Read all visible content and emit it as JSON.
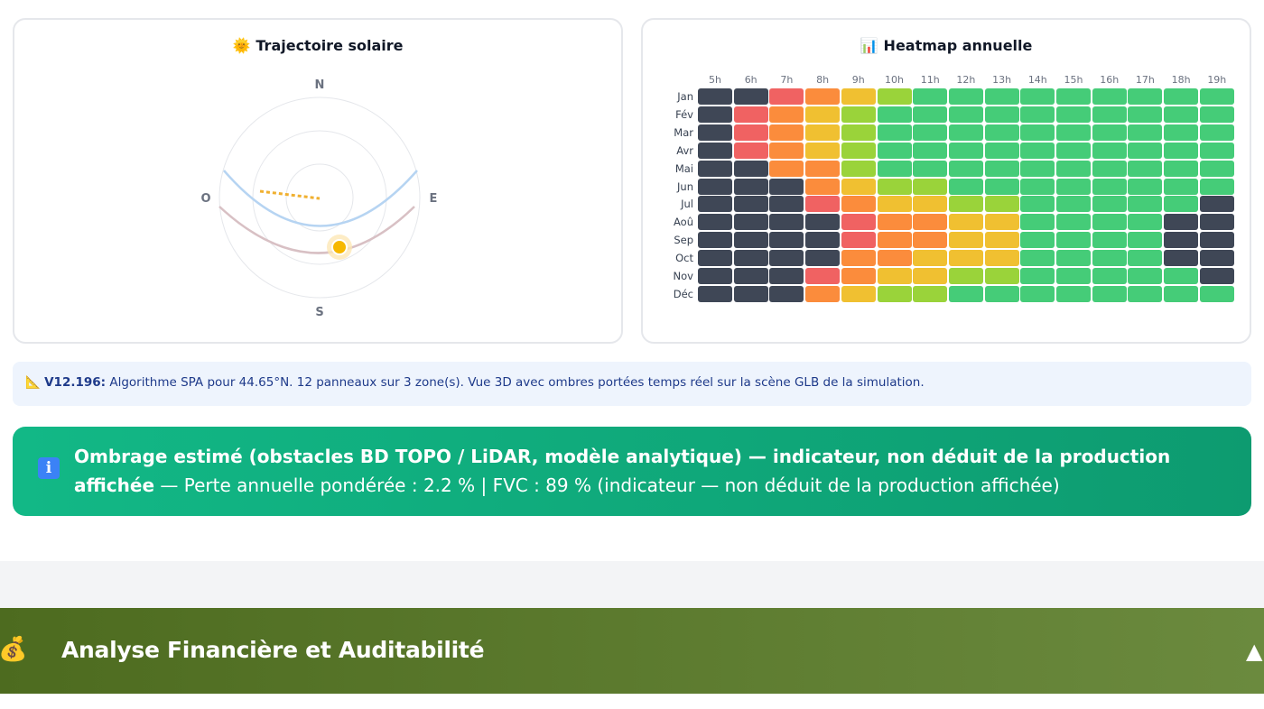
{
  "solar_card": {
    "icon": "🌞",
    "title": "Trajectoire solaire",
    "compass": {
      "n": "N",
      "s": "S",
      "e": "E",
      "o": "O"
    }
  },
  "heatmap_card": {
    "icon": "📊",
    "title": "Heatmap annuelle",
    "hours": [
      "5h",
      "6h",
      "7h",
      "8h",
      "9h",
      "10h",
      "11h",
      "12h",
      "13h",
      "14h",
      "15h",
      "16h",
      "17h",
      "18h",
      "19h"
    ],
    "months": [
      "Jan",
      "Fév",
      "Mar",
      "Avr",
      "Mai",
      "Jun",
      "Jul",
      "Aoû",
      "Sep",
      "Oct",
      "Nov",
      "Déc"
    ],
    "levels": [
      [
        0,
        0,
        1,
        2,
        3,
        4,
        5,
        5,
        5,
        5,
        5,
        5,
        5,
        5,
        5
      ],
      [
        0,
        1,
        2,
        3,
        4,
        5,
        5,
        5,
        5,
        5,
        5,
        5,
        5,
        5,
        5
      ],
      [
        0,
        1,
        2,
        3,
        4,
        5,
        5,
        5,
        5,
        5,
        5,
        5,
        5,
        5,
        5
      ],
      [
        0,
        1,
        2,
        3,
        4,
        5,
        5,
        5,
        5,
        5,
        5,
        5,
        5,
        5,
        5
      ],
      [
        0,
        0,
        2,
        2,
        4,
        5,
        5,
        5,
        5,
        5,
        5,
        5,
        5,
        5,
        5
      ],
      [
        0,
        0,
        0,
        2,
        3,
        4,
        4,
        5,
        5,
        5,
        5,
        5,
        5,
        5,
        5
      ],
      [
        0,
        0,
        0,
        1,
        2,
        3,
        3,
        4,
        4,
        5,
        5,
        5,
        5,
        5,
        0
      ],
      [
        0,
        0,
        0,
        0,
        1,
        2,
        2,
        3,
        3,
        5,
        5,
        5,
        5,
        0,
        0
      ],
      [
        0,
        0,
        0,
        0,
        1,
        2,
        2,
        3,
        3,
        5,
        5,
        5,
        5,
        0,
        0
      ],
      [
        0,
        0,
        0,
        0,
        2,
        2,
        3,
        3,
        3,
        5,
        5,
        5,
        5,
        0,
        0
      ],
      [
        0,
        0,
        0,
        1,
        2,
        3,
        3,
        4,
        4,
        5,
        5,
        5,
        5,
        5,
        0
      ],
      [
        0,
        0,
        0,
        2,
        3,
        4,
        4,
        5,
        5,
        5,
        5,
        5,
        5,
        5,
        5
      ]
    ],
    "palette": [
      "#3f4756",
      "#f06262",
      "#fb8c3c",
      "#f0c031",
      "#9ad33a",
      "#45cc78"
    ]
  },
  "info": {
    "icon": "📐",
    "version": "V12.196:",
    "text": " Algorithme SPA pour 44.65°N. 12 panneaux sur 3 zone(s). Vue 3D avec ombres portées temps réel sur la scène GLB de la simulation."
  },
  "banner": {
    "icon": "i",
    "title": "Ombrage estimé (obstacles BD TOPO / LiDAR, modèle analytique) — indicateur, non déduit de la production affichée",
    "detail": " — Perte annuelle pondérée : 2.2 % | FVC : 89 % (indicateur — non déduit de la production affichée)"
  },
  "section": {
    "icon": "💰",
    "title": "Analyse Financière et Auditabilité",
    "caret": "▲"
  }
}
